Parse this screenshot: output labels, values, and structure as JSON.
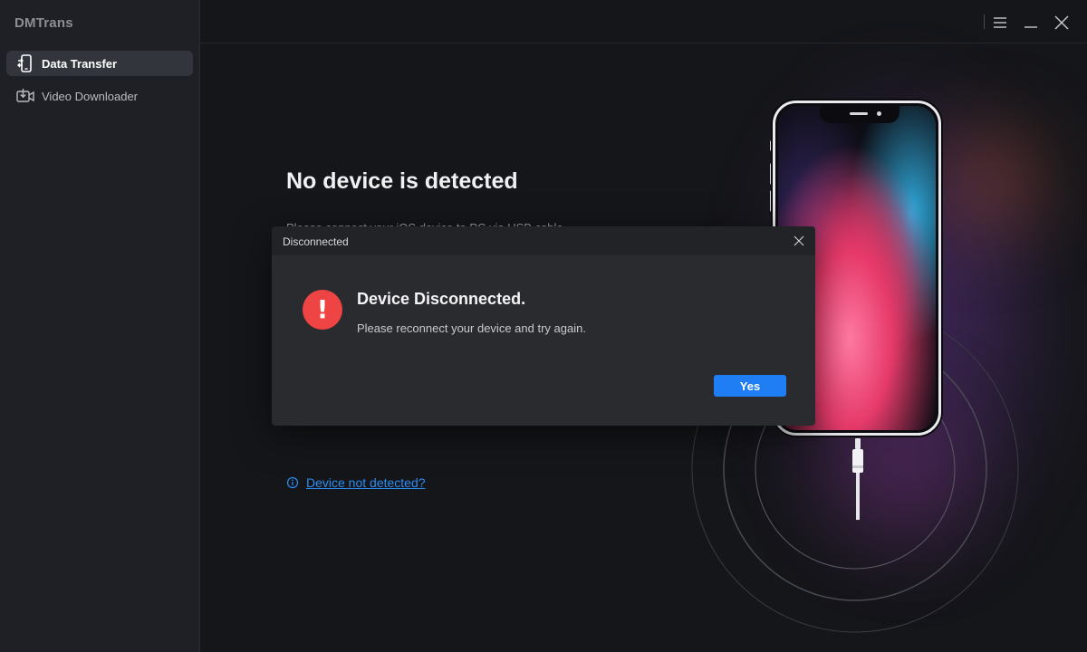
{
  "app": {
    "title": "DMTrans"
  },
  "sidebar": {
    "items": [
      {
        "label": "Data Transfer",
        "icon": "phone-transfer-icon",
        "active": true
      },
      {
        "label": "Video Downloader",
        "icon": "video-download-icon",
        "active": false
      }
    ]
  },
  "window_controls": {
    "menu": "menu-icon",
    "minimize": "minimize-icon",
    "close": "close-icon"
  },
  "main": {
    "headline": "No device is detected",
    "subline": "Please connect your iOS device to PC via USB cable.",
    "help_link": "Device not detected?"
  },
  "dialog": {
    "title": "Disconnected",
    "heading": "Device Disconnected.",
    "message": "Please reconnect your device and try again.",
    "confirm_label": "Yes"
  },
  "colors": {
    "accent": "#1f7ef3",
    "link": "#2b8cf2",
    "alert": "#ef4444",
    "sidebar_bg": "#1f2026",
    "main_bg": "#15161a",
    "dialog_bg": "#2a2b2e"
  }
}
